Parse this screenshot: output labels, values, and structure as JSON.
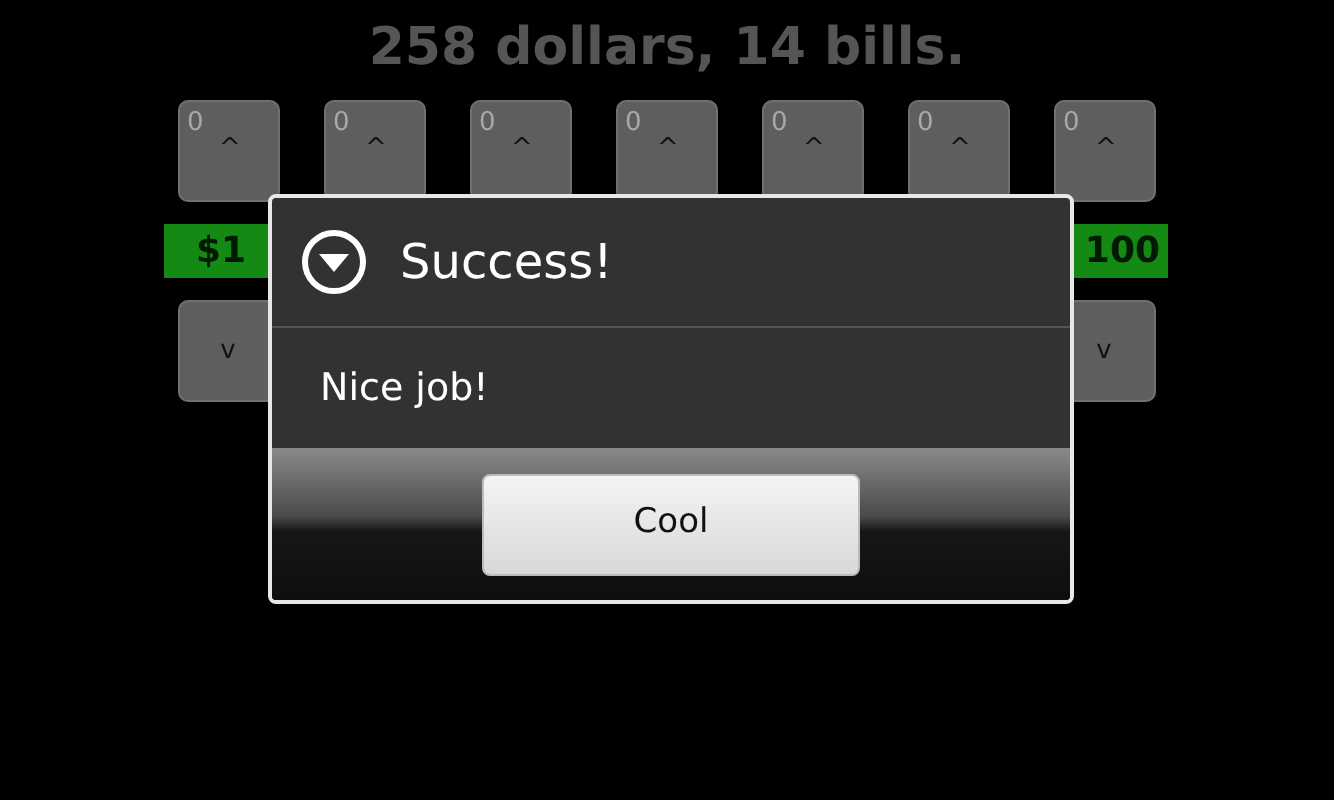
{
  "total": "258 dollars, 14 bills.",
  "columns": [
    {
      "count": "0",
      "up": "^",
      "label": "$1",
      "down": "v"
    },
    {
      "count": "0",
      "up": "^"
    },
    {
      "count": "0",
      "up": "^"
    },
    {
      "count": "0",
      "up": "^"
    },
    {
      "count": "0",
      "up": "^"
    },
    {
      "count": "0",
      "up": "^"
    },
    {
      "count": "0",
      "up": "^",
      "label": "100",
      "down": "v"
    }
  ],
  "dialog": {
    "title": "Success!",
    "message": "Nice job!",
    "button": "Cool"
  }
}
